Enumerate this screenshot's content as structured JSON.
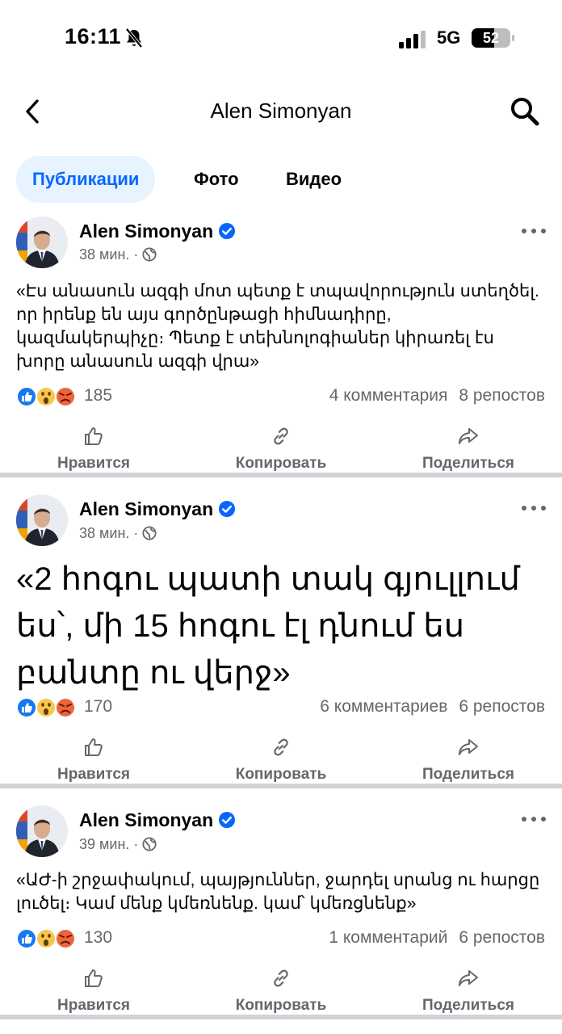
{
  "status_bar": {
    "time": "16:11",
    "network": "5G",
    "battery": "52"
  },
  "nav": {
    "title": "Alen Simonyan"
  },
  "tabs": [
    {
      "label": "Публикации",
      "active": true
    },
    {
      "label": "Фото",
      "active": false
    },
    {
      "label": "Видео",
      "active": false
    }
  ],
  "actions": {
    "like": "Нравится",
    "copy": "Копировать",
    "share": "Поделиться"
  },
  "posts": [
    {
      "author": "Alen Simonyan",
      "time": "38 мин.",
      "text": "«Էս անասուն ազգի մոտ պետք է տպավորություն ստեղծել. որ իրենք են այս գործընթացի հիմնադիրը, կազմակերպիչը։ Պետք է տեխնոլոգիաներ կիրառել էս խորը անասուն ազգի վրա»",
      "reactions": "185",
      "comments": "4 комментария",
      "reposts": "8 репостов"
    },
    {
      "author": "Alen Simonyan",
      "time": "38 мин.",
      "text": "«2 հոգու պատի տակ գյուլլում ես՝, մի 15 հոգու էլ դնում ես բանտը ու վերջ»",
      "reactions": "170",
      "comments": "6 комментариев",
      "reposts": "6 репостов"
    },
    {
      "author": "Alen Simonyan",
      "time": "39 мин.",
      "text": "«ԱԺ-ի շրջափակում, պայթյուններ, ջարդել սրանց ու հարցը լուծել։ Կամ մենք կմեռնենք. կամ՝ կմեռցնենք»",
      "reactions": "130",
      "comments": "1 комментарий",
      "reposts": "6 репостов"
    }
  ],
  "colors": {
    "accent": "#0866ff",
    "tab_bg": "#e7f3ff",
    "muted": "#65676b",
    "divider": "#cfd3d8"
  }
}
